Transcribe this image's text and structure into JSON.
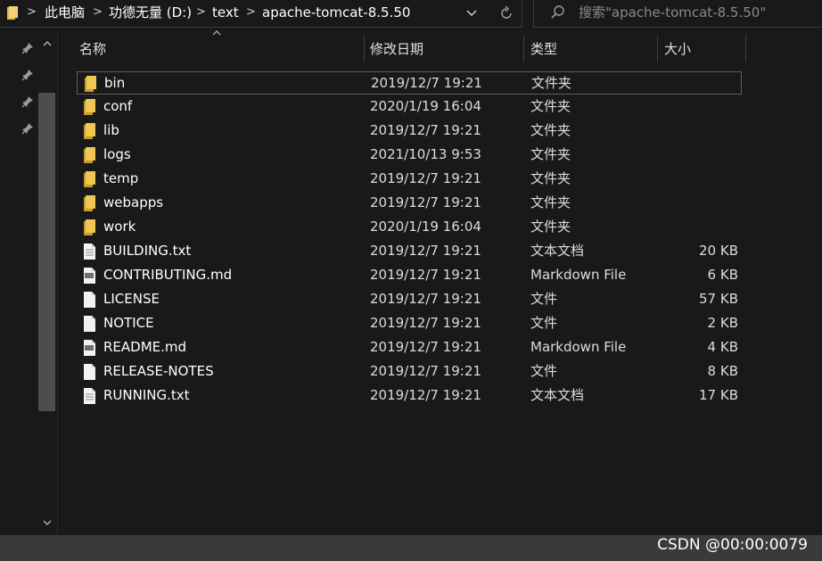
{
  "address_bar": {
    "breadcrumbs": [
      "此电脑",
      "功德无量 (D:)",
      "text",
      "apache-tomcat-8.5.50"
    ],
    "separator": ">",
    "dropdown_icon": "chevron-down",
    "refresh_icon": "refresh"
  },
  "search": {
    "placeholder": "搜索\"apache-tomcat-8.5.50\""
  },
  "columns": {
    "name": "名称",
    "date": "修改日期",
    "type": "类型",
    "size": "大小"
  },
  "files": [
    {
      "name": "bin",
      "date": "2019/12/7 19:21",
      "type": "文件夹",
      "size": "",
      "icon": "folder"
    },
    {
      "name": "conf",
      "date": "2020/1/19 16:04",
      "type": "文件夹",
      "size": "",
      "icon": "folder"
    },
    {
      "name": "lib",
      "date": "2019/12/7 19:21",
      "type": "文件夹",
      "size": "",
      "icon": "folder"
    },
    {
      "name": "logs",
      "date": "2021/10/13 9:53",
      "type": "文件夹",
      "size": "",
      "icon": "folder"
    },
    {
      "name": "temp",
      "date": "2019/12/7 19:21",
      "type": "文件夹",
      "size": "",
      "icon": "folder"
    },
    {
      "name": "webapps",
      "date": "2019/12/7 19:21",
      "type": "文件夹",
      "size": "",
      "icon": "folder"
    },
    {
      "name": "work",
      "date": "2020/1/19 16:04",
      "type": "文件夹",
      "size": "",
      "icon": "folder"
    },
    {
      "name": "BUILDING.txt",
      "date": "2019/12/7 19:21",
      "type": "文本文档",
      "size": "20 KB",
      "icon": "text-file"
    },
    {
      "name": "CONTRIBUTING.md",
      "date": "2019/12/7 19:21",
      "type": "Markdown File",
      "size": "6 KB",
      "icon": "markdown-file"
    },
    {
      "name": "LICENSE",
      "date": "2019/12/7 19:21",
      "type": "文件",
      "size": "57 KB",
      "icon": "blank-file"
    },
    {
      "name": "NOTICE",
      "date": "2019/12/7 19:21",
      "type": "文件",
      "size": "2 KB",
      "icon": "blank-file"
    },
    {
      "name": "README.md",
      "date": "2019/12/7 19:21",
      "type": "Markdown File",
      "size": "4 KB",
      "icon": "markdown-file"
    },
    {
      "name": "RELEASE-NOTES",
      "date": "2019/12/7 19:21",
      "type": "文件",
      "size": "8 KB",
      "icon": "blank-file"
    },
    {
      "name": "RUNNING.txt",
      "date": "2019/12/7 19:21",
      "type": "文本文档",
      "size": "17 KB",
      "icon": "text-file"
    }
  ],
  "selected_row": "bin",
  "watermark": "CSDN @00:00:0079",
  "colors": {
    "background": "#191919",
    "folder": "#e8b73f",
    "status_bar": "#3a3a3a"
  }
}
